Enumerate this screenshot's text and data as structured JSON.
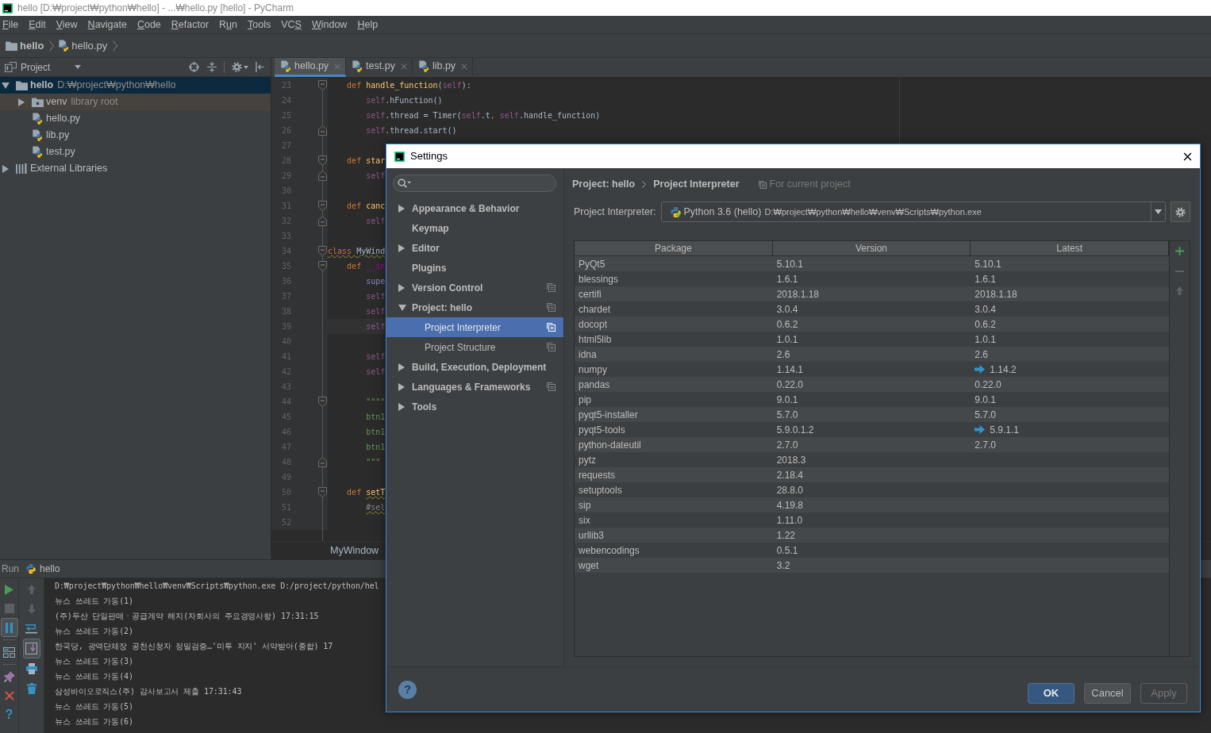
{
  "window": {
    "title": "hello [D:₩project₩python₩hello] - ...₩hello.py [hello] - PyCharm"
  },
  "menu": [
    {
      "label": "File",
      "kind": "first"
    },
    {
      "label": "Edit",
      "kind": "first"
    },
    {
      "label": "View",
      "kind": "first"
    },
    {
      "label": "Navigate",
      "kind": "first"
    },
    {
      "label": "Code",
      "kind": "first"
    },
    {
      "label": "Refactor",
      "kind": "first"
    },
    {
      "label": "Run",
      "kind": "second"
    },
    {
      "label": "Tools",
      "kind": "first"
    },
    {
      "label": "VCS",
      "kind": "third"
    },
    {
      "label": "Window",
      "kind": "first"
    },
    {
      "label": "Help",
      "kind": "first"
    }
  ],
  "navigation_bar": [
    {
      "label": "hello",
      "kind": "folder"
    },
    {
      "label": "hello.py",
      "kind": "python-file"
    }
  ],
  "project_panel": {
    "title": "Project",
    "tree": [
      {
        "label": "hello",
        "detail": "D:₩project₩python₩hello",
        "kind": "module",
        "expanded": true,
        "selected": true,
        "children": [
          {
            "label": "venv",
            "detail": "library root",
            "kind": "library-folder",
            "expanded": false,
            "selected": false,
            "color": "#46433e"
          },
          {
            "label": "hello.py",
            "kind": "python-file",
            "selected": false
          },
          {
            "label": "lib.py",
            "kind": "python-file",
            "selected": false
          },
          {
            "label": "test.py",
            "kind": "python-file",
            "selected": false
          }
        ]
      },
      {
        "label": "External Libraries",
        "kind": "libraries",
        "expanded": false,
        "selected": false
      }
    ]
  },
  "editor": {
    "tabs": [
      {
        "label": "hello.py",
        "selected": true
      },
      {
        "label": "test.py",
        "selected": false
      },
      {
        "label": "lib.py",
        "selected": false
      }
    ],
    "lines": [
      {
        "number": "23",
        "kind": "fold-start",
        "current": false,
        "tokens": [
          {
            "text": "    def ",
            "kind": "keyword",
            "warning": false
          },
          {
            "text": "handle_function",
            "kind": "function",
            "warning": false
          },
          {
            "text": "(",
            "kind": "plain",
            "warning": false
          },
          {
            "text": "self",
            "kind": "self",
            "warning": false
          },
          {
            "text": "):",
            "kind": "plain",
            "warning": false
          }
        ]
      },
      {
        "number": "24",
        "kind": "plain",
        "current": false,
        "tokens": [
          {
            "text": "        self",
            "kind": "self",
            "warning": false
          },
          {
            "text": ".hFunction()",
            "kind": "plain",
            "warning": false
          }
        ]
      },
      {
        "number": "25",
        "kind": "plain",
        "current": false,
        "tokens": [
          {
            "text": "        self",
            "kind": "self",
            "warning": false
          },
          {
            "text": ".thread = Timer(",
            "kind": "plain",
            "warning": false
          },
          {
            "text": "self",
            "kind": "self",
            "warning": false
          },
          {
            "text": ".t",
            "kind": "plain",
            "warning": false
          },
          {
            "text": ", ",
            "kind": "keyword",
            "warning": false
          },
          {
            "text": "self",
            "kind": "self",
            "warning": false
          },
          {
            "text": ".handle_function)",
            "kind": "plain",
            "warning": false
          }
        ]
      },
      {
        "number": "26",
        "kind": "fold-end",
        "current": false,
        "tokens": [
          {
            "text": "        self",
            "kind": "self",
            "warning": false
          },
          {
            "text": ".thread.start()",
            "kind": "plain",
            "warning": false
          }
        ]
      },
      {
        "number": "27",
        "kind": "plain",
        "current": false
      },
      {
        "number": "28",
        "kind": "fold-start",
        "current": false,
        "tokens": [
          {
            "text": "    def ",
            "kind": "keyword",
            "warning": false
          },
          {
            "text": "star",
            "kind": "function",
            "warning": false
          }
        ]
      },
      {
        "number": "29",
        "kind": "fold-end",
        "current": false,
        "tokens": [
          {
            "text": "        self",
            "kind": "self",
            "warning": false
          }
        ]
      },
      {
        "number": "30",
        "kind": "plain",
        "current": false
      },
      {
        "number": "31",
        "kind": "fold-start",
        "current": false,
        "tokens": [
          {
            "text": "    def ",
            "kind": "keyword",
            "warning": false
          },
          {
            "text": "canc",
            "kind": "function",
            "warning": false
          }
        ]
      },
      {
        "number": "32",
        "kind": "fold-end",
        "current": false,
        "tokens": [
          {
            "text": "        self",
            "kind": "self",
            "warning": false
          }
        ]
      },
      {
        "number": "33",
        "kind": "plain",
        "current": false
      },
      {
        "number": "34",
        "kind": "fold-start",
        "current": false,
        "tokens": [
          {
            "text": "class ",
            "kind": "keyword",
            "warning": true
          },
          {
            "text": "MyWind",
            "kind": "plain",
            "warning": true
          }
        ]
      },
      {
        "number": "35",
        "kind": "fold-start",
        "current": false,
        "tokens": [
          {
            "text": "    def ",
            "kind": "keyword",
            "warning": false
          },
          {
            "text": "__in",
            "kind": "magic",
            "warning": false
          }
        ]
      },
      {
        "number": "36",
        "kind": "plain",
        "current": false,
        "tokens": [
          {
            "text": "        supe",
            "kind": "builtin",
            "warning": false
          }
        ]
      },
      {
        "number": "37",
        "kind": "plain",
        "current": false,
        "tokens": [
          {
            "text": "        self",
            "kind": "self",
            "warning": false
          }
        ]
      },
      {
        "number": "38",
        "kind": "plain",
        "current": false,
        "tokens": [
          {
            "text": "        self",
            "kind": "self",
            "warning": false
          }
        ]
      },
      {
        "number": "39",
        "kind": "plain",
        "current": true,
        "tokens": [
          {
            "text": "        self",
            "kind": "self",
            "warning": false
          }
        ]
      },
      {
        "number": "40",
        "kind": "plain",
        "current": false
      },
      {
        "number": "41",
        "kind": "plain",
        "current": false,
        "tokens": [
          {
            "text": "        self",
            "kind": "self",
            "warning": false
          }
        ]
      },
      {
        "number": "42",
        "kind": "plain",
        "current": false,
        "tokens": [
          {
            "text": "        self",
            "kind": "self",
            "warning": false
          }
        ]
      },
      {
        "number": "43",
        "kind": "plain",
        "current": false
      },
      {
        "number": "44",
        "kind": "fold-start",
        "current": false,
        "tokens": [
          {
            "text": "        \"\"\"\"",
            "kind": "string",
            "warning": false
          }
        ]
      },
      {
        "number": "45",
        "kind": "plain",
        "current": false,
        "tokens": [
          {
            "text": "        btn1",
            "kind": "string",
            "warning": false
          }
        ]
      },
      {
        "number": "46",
        "kind": "plain",
        "current": false,
        "tokens": [
          {
            "text": "        btn1",
            "kind": "string",
            "warning": false
          }
        ]
      },
      {
        "number": "47",
        "kind": "plain",
        "current": false,
        "tokens": [
          {
            "text": "        btn1",
            "kind": "string",
            "warning": false
          }
        ]
      },
      {
        "number": "48",
        "kind": "fold-end",
        "current": false,
        "tokens": [
          {
            "text": "        \"\"\"",
            "kind": "string",
            "warning": false
          }
        ]
      },
      {
        "number": "49",
        "kind": "plain",
        "current": false
      },
      {
        "number": "50",
        "kind": "fold-start",
        "current": false,
        "tokens": [
          {
            "text": "    def ",
            "kind": "keyword",
            "warning": false
          },
          {
            "text": "setT",
            "kind": "function",
            "warning": true
          }
        ]
      },
      {
        "number": "51",
        "kind": "plain",
        "current": false,
        "tokens": [
          {
            "text": "        #sel",
            "kind": "comment",
            "warning": true
          }
        ]
      },
      {
        "number": "52",
        "kind": "plain",
        "current": false
      }
    ],
    "breadcrumb": "MyWindow"
  },
  "run_panel": {
    "title": "Run",
    "configuration": "hello",
    "toolbar_left": [
      [
        {
          "kind": "run",
          "disabled": false
        },
        {
          "kind": "stop",
          "disabled": true
        },
        {
          "kind": "pause",
          "disabled": false,
          "selected": true
        }
      ],
      [
        {
          "kind": "layout",
          "disabled": false
        }
      ],
      [
        {
          "kind": "pin",
          "disabled": false
        },
        {
          "kind": "close",
          "disabled": false
        },
        {
          "kind": "help",
          "disabled": false,
          "label": "?"
        }
      ]
    ],
    "toolbar_right": [
      [
        {
          "kind": "up",
          "disabled": true
        },
        {
          "kind": "down",
          "disabled": true
        },
        {
          "kind": "soft-wrap",
          "disabled": false,
          "selected": false
        },
        {
          "kind": "scroll-to-end",
          "disabled": false,
          "selected": true
        },
        {
          "kind": "print",
          "disabled": false
        },
        {
          "kind": "delete",
          "disabled": false
        }
      ]
    ],
    "output": [
      "D:₩project₩python₩hello₩venv₩Scripts₩python.exe D:/project/python/hel",
      "뉴스 쓰레드 가동(1)",
      "(주)두산 단일판매ㆍ공급계약 해지(자회사의 주요경영사항) 17:31:15",
      "뉴스 쓰레드 가동(2)",
      "한국당, 광역단체장 공천신청자 정밀검증…'미투 지지' 서약받아(종합) 17",
      "뉴스 쓰레드 가동(3)",
      "뉴스 쓰레드 가동(4)",
      "삼성바이오로직스(주) 감사보고서 제출 17:31:43",
      "뉴스 쓰레드 가동(5)",
      "뉴스 쓰레드 가동(6)"
    ]
  },
  "settings_dialog": {
    "title": "Settings",
    "tree": [
      {
        "label": "Appearance & Behavior",
        "expanded": false,
        "project_level": false,
        "selected": false
      },
      {
        "label": "Keymap",
        "project_level": false,
        "selected": false
      },
      {
        "label": "Editor",
        "expanded": false,
        "project_level": false,
        "selected": false
      },
      {
        "label": "Plugins",
        "project_level": false,
        "selected": false
      },
      {
        "label": "Version Control",
        "expanded": false,
        "project_level": true,
        "selected": false
      },
      {
        "label": "Project: hello",
        "expanded": true,
        "project_level": true,
        "selected": false,
        "children": [
          {
            "label": "Project Interpreter",
            "project_level": true,
            "selected": true
          },
          {
            "label": "Project Structure",
            "project_level": true,
            "selected": false
          }
        ]
      },
      {
        "label": "Build, Execution, Deployment",
        "expanded": false,
        "project_level": false,
        "selected": false
      },
      {
        "label": "Languages & Frameworks",
        "expanded": false,
        "project_level": true,
        "selected": false
      },
      {
        "label": "Tools",
        "expanded": false,
        "project_level": false,
        "selected": false
      }
    ],
    "breadcrumb": [
      "Project: hello",
      "Project Interpreter"
    ],
    "scope_note": "For current project",
    "interpreter": {
      "label": "Project Interpreter:",
      "name": "Python 3.6 (hello)",
      "path": "D:₩project₩python₩hello₩venv₩Scripts₩python.exe"
    },
    "packages": {
      "columns": [
        "Package",
        "Version",
        "Latest"
      ],
      "rows": [
        {
          "package": "PyQt5",
          "version": "5.10.1",
          "latest": "5.10.1",
          "upgrade": false
        },
        {
          "package": "blessings",
          "version": "1.6.1",
          "latest": "1.6.1",
          "upgrade": false
        },
        {
          "package": "certifi",
          "version": "2018.1.18",
          "latest": "2018.1.18",
          "upgrade": false
        },
        {
          "package": "chardet",
          "version": "3.0.4",
          "latest": "3.0.4",
          "upgrade": false
        },
        {
          "package": "docopt",
          "version": "0.6.2",
          "latest": "0.6.2",
          "upgrade": false
        },
        {
          "package": "html5lib",
          "version": "1.0.1",
          "latest": "1.0.1",
          "upgrade": false
        },
        {
          "package": "idna",
          "version": "2.6",
          "latest": "2.6",
          "upgrade": false
        },
        {
          "package": "numpy",
          "version": "1.14.1",
          "latest": "1.14.2",
          "upgrade": true
        },
        {
          "package": "pandas",
          "version": "0.22.0",
          "latest": "0.22.0",
          "upgrade": false
        },
        {
          "package": "pip",
          "version": "9.0.1",
          "latest": "9.0.1",
          "upgrade": false
        },
        {
          "package": "pyqt5-installer",
          "version": "5.7.0",
          "latest": "5.7.0",
          "upgrade": false
        },
        {
          "package": "pyqt5-tools",
          "version": "5.9.0.1.2",
          "latest": "5.9.1.1",
          "upgrade": true
        },
        {
          "package": "python-dateutil",
          "version": "2.7.0",
          "latest": "2.7.0",
          "upgrade": false
        },
        {
          "package": "pytz",
          "version": "2018.3",
          "upgrade": false
        },
        {
          "package": "requests",
          "version": "2.18.4",
          "upgrade": false
        },
        {
          "package": "setuptools",
          "version": "28.8.0",
          "upgrade": false
        },
        {
          "package": "sip",
          "version": "4.19.8",
          "upgrade": false
        },
        {
          "package": "six",
          "version": "1.11.0",
          "upgrade": false
        },
        {
          "package": "urllib3",
          "version": "1.22",
          "upgrade": false
        },
        {
          "package": "webencodings",
          "version": "0.5.1",
          "upgrade": false
        },
        {
          "package": "wget",
          "version": "3.2",
          "upgrade": false
        }
      ]
    },
    "package_actions": [
      {
        "kind": "add",
        "disabled": false
      },
      {
        "kind": "remove",
        "disabled": true
      },
      {
        "kind": "upgrade",
        "disabled": true
      }
    ],
    "help": "?",
    "buttons": [
      {
        "label": "OK",
        "default": true,
        "disabled": false
      },
      {
        "label": "Cancel",
        "default": false,
        "disabled": false
      },
      {
        "label": "Apply",
        "default": false,
        "disabled": true
      }
    ]
  }
}
